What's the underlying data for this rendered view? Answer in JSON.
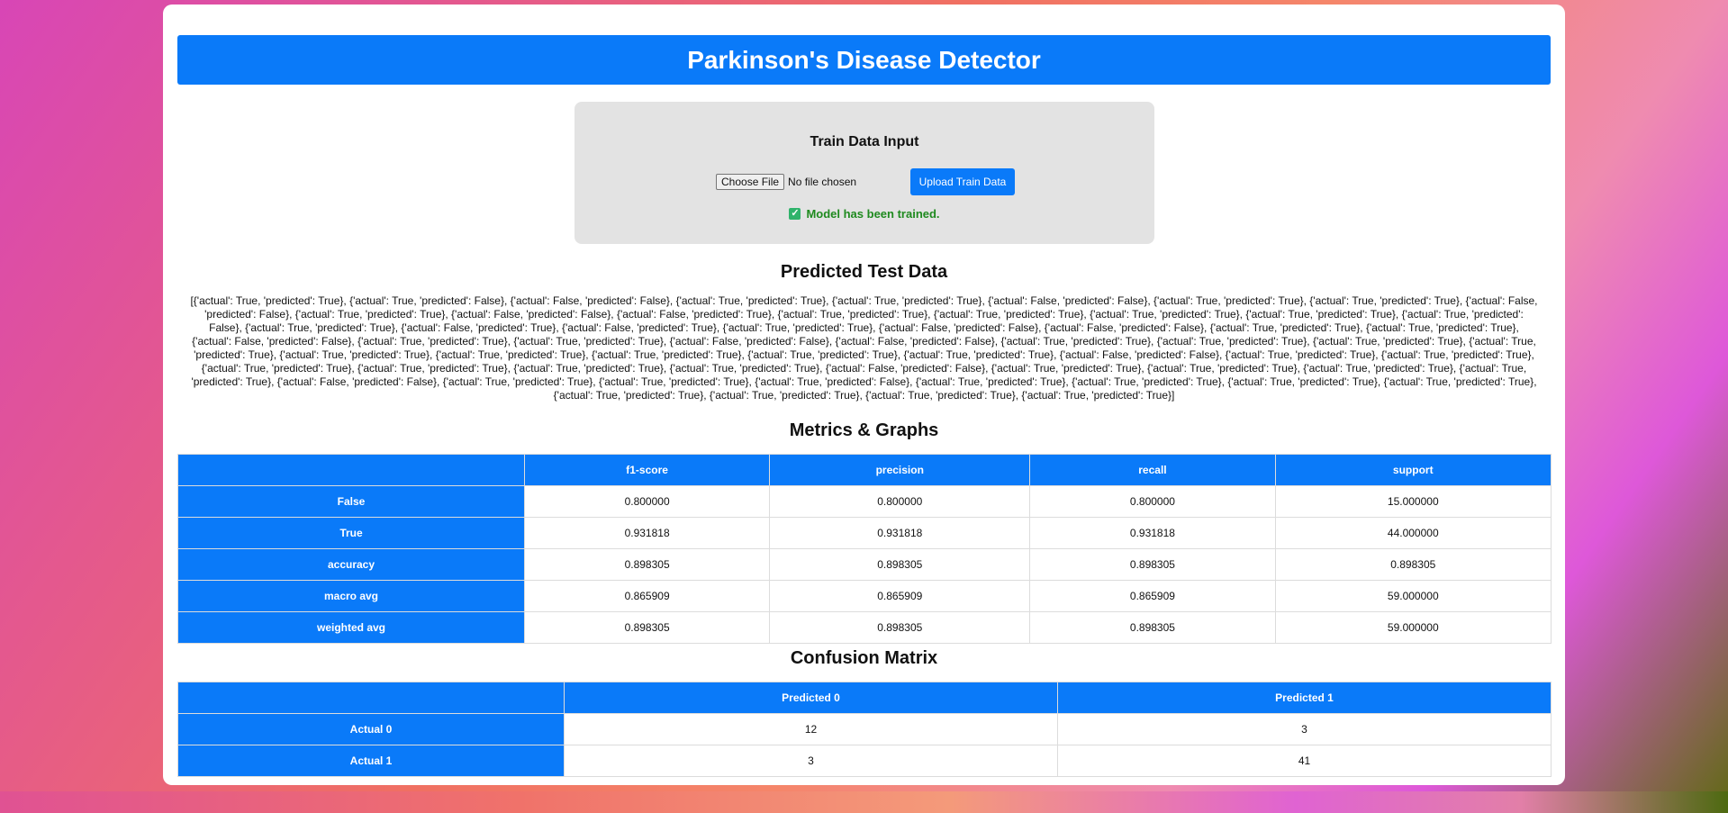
{
  "header": {
    "title": "Parkinson's Disease Detector"
  },
  "train": {
    "title": "Train Data Input",
    "choose_label": "Choose File",
    "file_status": "No file chosen",
    "upload_label": "Upload Train Data",
    "status_text": "Model has been trained."
  },
  "predicted": {
    "title": "Predicted Test Data",
    "text": "[{'actual': True, 'predicted': True}, {'actual': True, 'predicted': False}, {'actual': False, 'predicted': False}, {'actual': True, 'predicted': True}, {'actual': True, 'predicted': True}, {'actual': False, 'predicted': False}, {'actual': True, 'predicted': True}, {'actual': True, 'predicted': True}, {'actual': False, 'predicted': False}, {'actual': True, 'predicted': True}, {'actual': False, 'predicted': False}, {'actual': False, 'predicted': True}, {'actual': True, 'predicted': True}, {'actual': True, 'predicted': True}, {'actual': True, 'predicted': True}, {'actual': True, 'predicted': True}, {'actual': True, 'predicted': False}, {'actual': True, 'predicted': True}, {'actual': False, 'predicted': True}, {'actual': False, 'predicted': True}, {'actual': True, 'predicted': True}, {'actual': False, 'predicted': False}, {'actual': False, 'predicted': False}, {'actual': True, 'predicted': True}, {'actual': True, 'predicted': True}, {'actual': False, 'predicted': False}, {'actual': True, 'predicted': True}, {'actual': True, 'predicted': True}, {'actual': False, 'predicted': False}, {'actual': False, 'predicted': False}, {'actual': True, 'predicted': True}, {'actual': True, 'predicted': True}, {'actual': True, 'predicted': True}, {'actual': True, 'predicted': True}, {'actual': True, 'predicted': True}, {'actual': True, 'predicted': True}, {'actual': True, 'predicted': True}, {'actual': True, 'predicted': True}, {'actual': True, 'predicted': True}, {'actual': False, 'predicted': False}, {'actual': True, 'predicted': True}, {'actual': True, 'predicted': True}, {'actual': True, 'predicted': True}, {'actual': True, 'predicted': True}, {'actual': True, 'predicted': True}, {'actual': True, 'predicted': True}, {'actual': False, 'predicted': False}, {'actual': True, 'predicted': True}, {'actual': True, 'predicted': True}, {'actual': True, 'predicted': True}, {'actual': True, 'predicted': True}, {'actual': False, 'predicted': False}, {'actual': True, 'predicted': True}, {'actual': True, 'predicted': True}, {'actual': True, 'predicted': False}, {'actual': True, 'predicted': True}, {'actual': True, 'predicted': True}, {'actual': True, 'predicted': True}, {'actual': True, 'predicted': True}, {'actual': True, 'predicted': True}, {'actual': True, 'predicted': True}, {'actual': True, 'predicted': True}, {'actual': True, 'predicted': True}]"
  },
  "metrics": {
    "title": "Metrics & Graphs",
    "columns": [
      "",
      "f1-score",
      "precision",
      "recall",
      "support"
    ],
    "rows": [
      {
        "label": "False",
        "values": [
          "0.800000",
          "0.800000",
          "0.800000",
          "15.000000"
        ]
      },
      {
        "label": "True",
        "values": [
          "0.931818",
          "0.931818",
          "0.931818",
          "44.000000"
        ]
      },
      {
        "label": "accuracy",
        "values": [
          "0.898305",
          "0.898305",
          "0.898305",
          "0.898305"
        ]
      },
      {
        "label": "macro avg",
        "values": [
          "0.865909",
          "0.865909",
          "0.865909",
          "59.000000"
        ]
      },
      {
        "label": "weighted avg",
        "values": [
          "0.898305",
          "0.898305",
          "0.898305",
          "59.000000"
        ]
      }
    ]
  },
  "confusion": {
    "title": "Confusion Matrix",
    "columns": [
      "",
      "Predicted 0",
      "Predicted 1"
    ],
    "rows": [
      {
        "label": "Actual 0",
        "values": [
          "12",
          "3"
        ]
      },
      {
        "label": "Actual 1",
        "values": [
          "3",
          "41"
        ]
      }
    ]
  },
  "colors": {
    "accent": "#0a7af9",
    "success": "#1f8a1f"
  }
}
